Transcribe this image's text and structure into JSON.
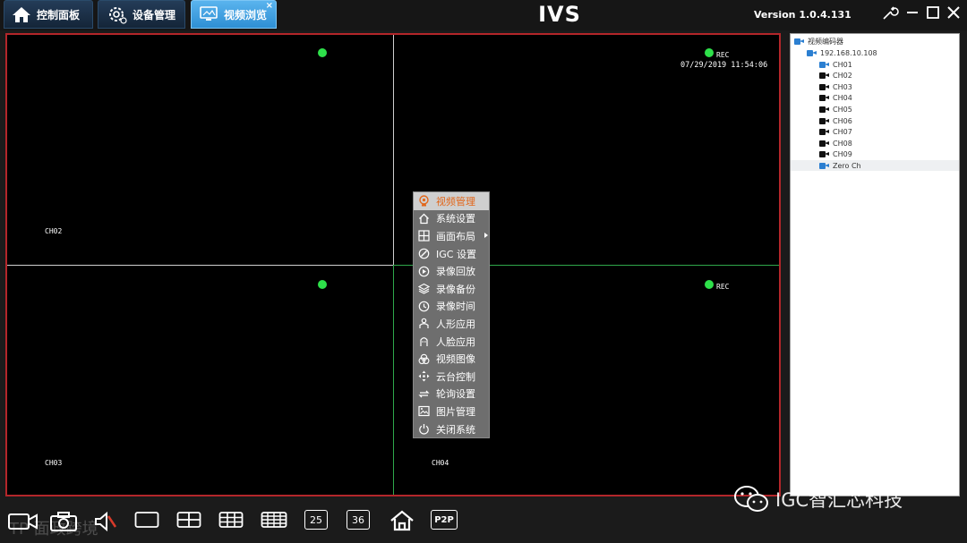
{
  "tabs": [
    {
      "label": "控制面板",
      "icon": "home-icon",
      "active": false
    },
    {
      "label": "设备管理",
      "icon": "gear-icon",
      "active": false
    },
    {
      "label": "视频浏览",
      "icon": "monitor-icon",
      "active": true,
      "close": "×"
    }
  ],
  "app_title": "IVS",
  "version": "Version 1.0.4.131",
  "window_controls": [
    "wrench-icon",
    "minimize-icon",
    "maximize-icon",
    "close-icon"
  ],
  "video": {
    "channels": [
      "CH02",
      "CH03",
      "CH04"
    ],
    "rec_label": "REC",
    "datetime": "07/29/2019 11:54:06",
    "dot_color": "#2ee04a",
    "border_color": "#b3262a"
  },
  "tree": {
    "root": "视频编码器",
    "device": "192.168.10.108",
    "channels": [
      "CH01",
      "CH02",
      "CH03",
      "CH04",
      "CH05",
      "CH06",
      "CH07",
      "CH08",
      "CH09",
      "Zero Ch"
    ]
  },
  "context_menu": [
    {
      "label": "视频管理",
      "icon": "video-manage-icon",
      "highlight": true
    },
    {
      "label": "系统设置",
      "icon": "home-icon"
    },
    {
      "label": "画面布局",
      "icon": "layout-icon",
      "submenu": true
    },
    {
      "label": "IGC 设置",
      "icon": "igc-icon"
    },
    {
      "label": "录像回放",
      "icon": "playback-icon"
    },
    {
      "label": "录像备份",
      "icon": "layers-icon"
    },
    {
      "label": "录像时间",
      "icon": "clock-icon"
    },
    {
      "label": "人形应用",
      "icon": "person-icon"
    },
    {
      "label": "人脸应用",
      "icon": "face-icon"
    },
    {
      "label": "视频图像",
      "icon": "image-adjust-icon"
    },
    {
      "label": "云台控制",
      "icon": "ptz-icon"
    },
    {
      "label": "轮询设置",
      "icon": "cycle-icon"
    },
    {
      "label": "图片管理",
      "icon": "picture-icon"
    },
    {
      "label": "关闭系统",
      "icon": "power-icon"
    }
  ],
  "bottom_toolbar": {
    "layout_25": "25",
    "layout_36": "36",
    "p2p": "P2P"
  },
  "watermarks": {
    "brand": "IGC智汇芯科技",
    "corner": "TP 面政跨境"
  },
  "accent_color": "#2e8fd4"
}
